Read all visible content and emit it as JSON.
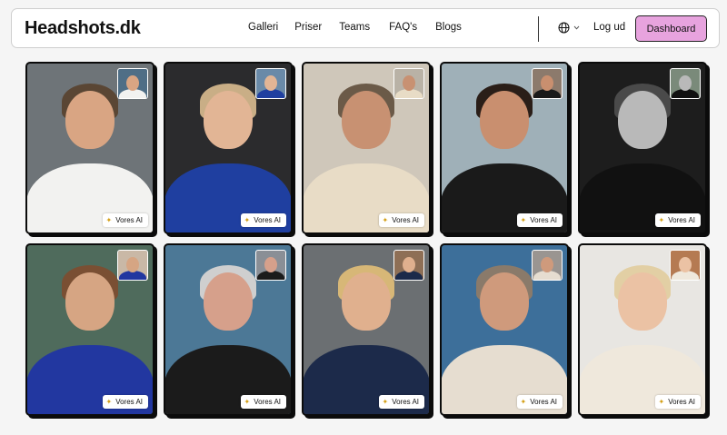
{
  "navbar": {
    "logo": "Headshots.dk",
    "links": [
      "Galleri",
      "Priser",
      "Teams",
      "FAQ's",
      "Blogs"
    ],
    "language_icon": "globe-icon",
    "logout": "Log ud",
    "dashboard": "Dashboard",
    "dashboard_color": "#e7a3de"
  },
  "gallery": {
    "badge_label": "Vores AI",
    "badge_icon": "sparkle-icon",
    "cards": [
      {
        "bg": "#6e7478",
        "skin": "#d9a583",
        "hair": "#5a4634",
        "clothing": "#f2f2f0",
        "thumb_bg": "#4f6e86"
      },
      {
        "bg": "#2b2b2d",
        "skin": "#e2b595",
        "hair": "#c9ae86",
        "clothing": "#1f3fa0",
        "thumb_bg": "#6a8aa8"
      },
      {
        "bg": "#cfc7ba",
        "skin": "#c89172",
        "hair": "#6b5a48",
        "clothing": "#e8dcc6",
        "thumb_bg": "#b9b2a6"
      },
      {
        "bg": "#9fb0b8",
        "skin": "#c98f6f",
        "hair": "#2a1e18",
        "clothing": "#1a1a1a",
        "thumb_bg": "#8c7a6c"
      },
      {
        "bg": "#1d1d1d",
        "skin": "#b9b9b9",
        "hair": "#4a4a4a",
        "clothing": "#111111",
        "thumb_bg": "#7a8a7a"
      },
      {
        "bg": "#4f6b5c",
        "skin": "#d6a583",
        "hair": "#7a4f33",
        "clothing": "#2237a0",
        "thumb_bg": "#c9b8a6"
      },
      {
        "bg": "#4c7896",
        "skin": "#d6a08b",
        "hair": "#cfcfcf",
        "clothing": "#1b1b1b",
        "thumb_bg": "#8a8f96"
      },
      {
        "bg": "#6b6f72",
        "skin": "#e0b08e",
        "hair": "#d7b777",
        "clothing": "#1c2a4a",
        "thumb_bg": "#8e6f56"
      },
      {
        "bg": "#3d6f9a",
        "skin": "#cf9a7c",
        "hair": "#8a7a6a",
        "clothing": "#e6ddd0",
        "thumb_bg": "#9a9591"
      },
      {
        "bg": "#e8e6e2",
        "skin": "#ebc2a4",
        "hair": "#e2cfa4",
        "clothing": "#efe8dc",
        "thumb_bg": "#b57a52"
      }
    ]
  }
}
